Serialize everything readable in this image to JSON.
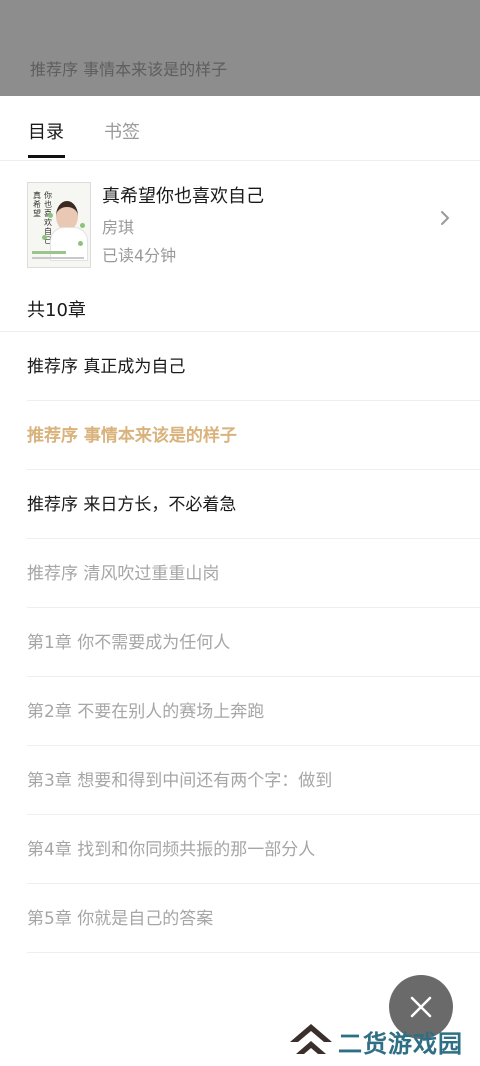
{
  "overlay": {
    "current_title": "推荐序 事情本来该是的样子"
  },
  "tabs": {
    "toc_label": "目录",
    "bookmarks_label": "书签"
  },
  "book": {
    "title": "真希望你也喜欢自己",
    "author": "房琪",
    "progress": "已读4分钟",
    "cover_text_1": "真希望",
    "cover_text_2": "你也喜欢自己"
  },
  "toc": {
    "count_label": "共10章",
    "chapters": [
      {
        "title": "推荐序 真正成为自己",
        "state": "read"
      },
      {
        "title": "推荐序 事情本来该是的样子",
        "state": "current"
      },
      {
        "title": "推荐序 来日方长，不必着急",
        "state": "read"
      },
      {
        "title": "推荐序 清风吹过重重山岗",
        "state": "unread"
      },
      {
        "title": "第1章 你不需要成为任何人",
        "state": "unread"
      },
      {
        "title": "第2章 不要在别人的赛场上奔跑",
        "state": "unread"
      },
      {
        "title": "第3章 想要和得到中间还有两个字：做到",
        "state": "unread"
      },
      {
        "title": "第4章 找到和你同频共振的那一部分人",
        "state": "unread"
      },
      {
        "title": "第5章 你就是自己的答案",
        "state": "unread"
      }
    ]
  },
  "watermark": {
    "text": "二货游戏园"
  },
  "colors": {
    "accent": "#d9b27c",
    "unread": "#a6a6a6",
    "dim": "#8d8d8d",
    "watermark": "#2e6f85"
  }
}
